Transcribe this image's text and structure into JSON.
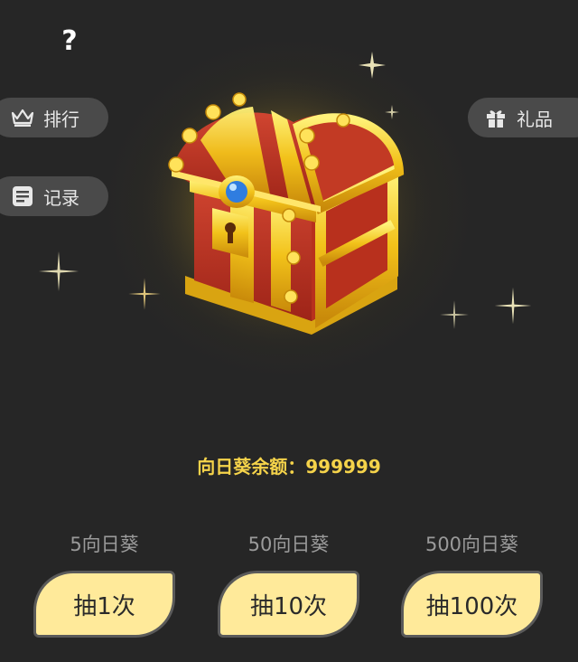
{
  "header": {
    "help_label": "?"
  },
  "left_menu": {
    "rank_label": "排行",
    "record_label": "记录"
  },
  "right_menu": {
    "gift_label": "礼品"
  },
  "balance": {
    "text": "向日葵余额：999999"
  },
  "draws": [
    {
      "cost": "5向日葵",
      "button": "抽1次"
    },
    {
      "cost": "50向日葵",
      "button": "抽10次"
    },
    {
      "cost": "500向日葵",
      "button": "抽100次"
    }
  ],
  "colors": {
    "background": "#262626",
    "accent_gold": "#f5d34a",
    "button_fill": "#ffea9a",
    "pill_bg": "#4a4a4a"
  },
  "icons": [
    "crown-icon",
    "list-icon",
    "gift-icon",
    "treasure-chest"
  ]
}
